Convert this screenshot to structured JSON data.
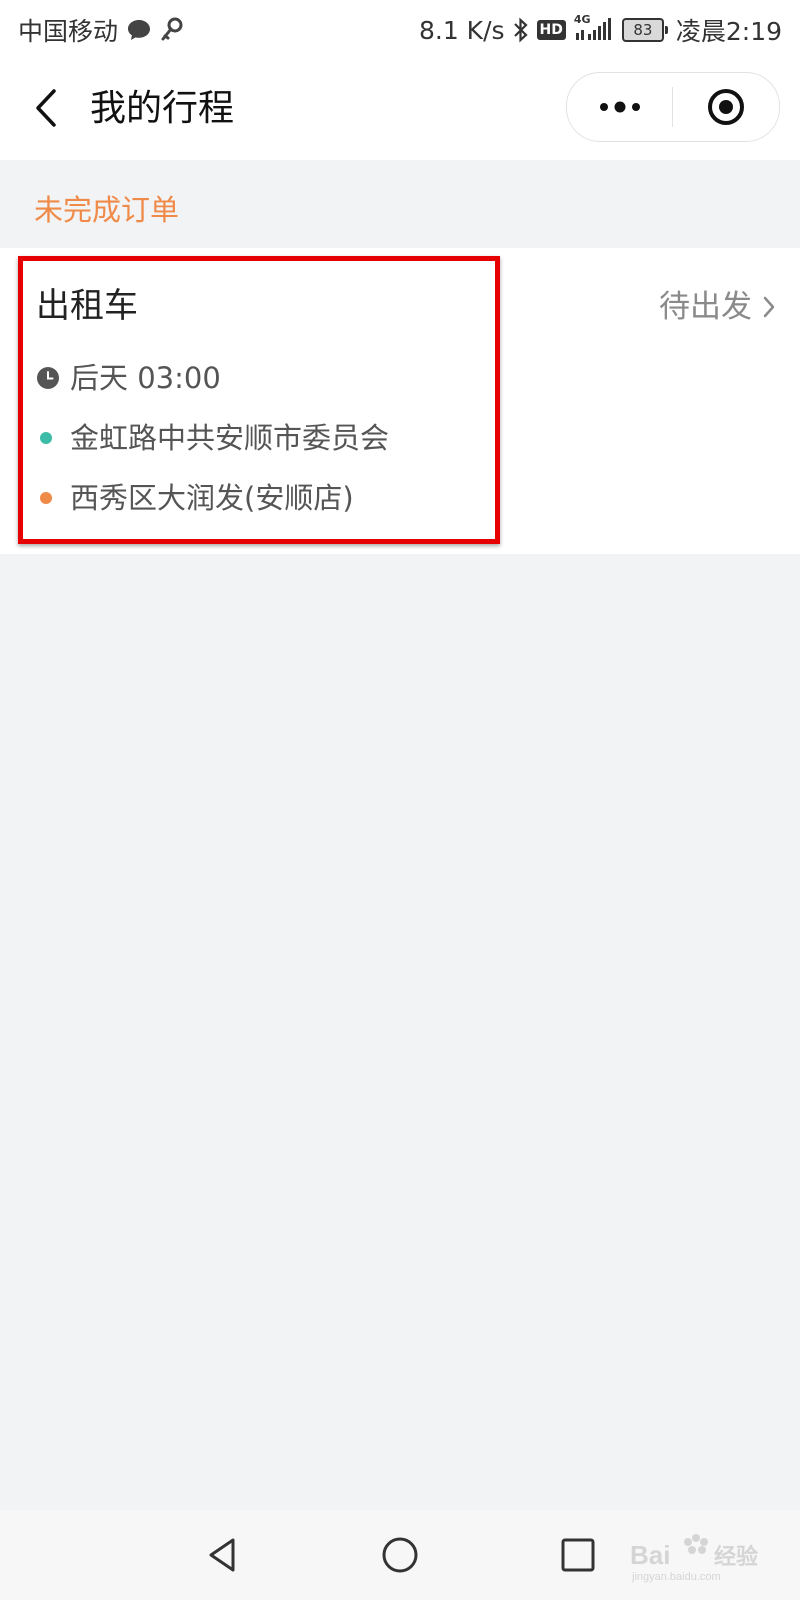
{
  "status_bar": {
    "carrier": "中国移动",
    "net_speed": "8.1 K/s",
    "hd_label": "HD",
    "network_type": "4G",
    "battery_level": "83",
    "time": "凌晨2:19",
    "icons": [
      "chat-bubble-icon",
      "key-icon",
      "bluetooth-icon",
      "signal-icon",
      "battery-icon"
    ]
  },
  "nav": {
    "title": "我的行程",
    "back_icon": "chevron-left-icon",
    "more_icon": "more-dots-icon",
    "close_icon": "target-circle-icon"
  },
  "section": {
    "title": "未完成订单"
  },
  "order": {
    "type": "出租车",
    "status": "待出发",
    "time": "后天 03:00",
    "from": "金虹路中共安顺市委员会",
    "to": "西秀区大润发(安顺店)"
  },
  "colors": {
    "accent": "#f08a48",
    "from_dot": "#3cbca7",
    "to_dot": "#f08a48",
    "highlight": "#e60000",
    "background": "#f2f3f5"
  },
  "system_nav": {
    "buttons": [
      "back-triangle-icon",
      "home-circle-icon",
      "recent-square-icon"
    ]
  }
}
